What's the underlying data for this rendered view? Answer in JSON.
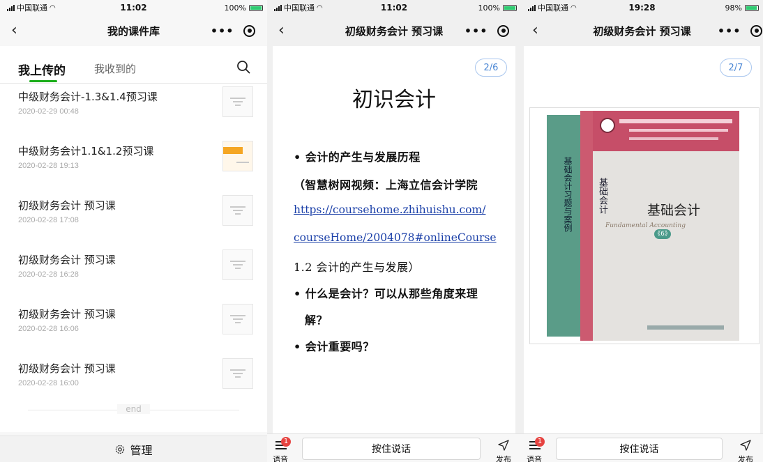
{
  "status_bars": [
    {
      "carrier": "中国联通",
      "time": "11:02",
      "battery": "100%"
    },
    {
      "carrier": "中国联通",
      "time": "11:02",
      "battery": "100%"
    },
    {
      "carrier": "中国联通",
      "time": "19:28",
      "battery": "98%"
    }
  ],
  "panel1": {
    "title": "我的课件库",
    "tabs": {
      "active": "我上传的",
      "inactive": "我收到的"
    },
    "items": [
      {
        "name": "中级财务会计-1.3&1.4预习课",
        "date": "2020-02-29 00:48"
      },
      {
        "name": "中级财务会计1.1&1.2预习课",
        "date": "2020-02-28 19:13"
      },
      {
        "name": "初级财务会计 预习课",
        "date": "2020-02-28 17:08"
      },
      {
        "name": "初级财务会计 预习课",
        "date": "2020-02-28 16:28"
      },
      {
        "name": "初级财务会计 预习课",
        "date": "2020-02-28 16:06"
      },
      {
        "name": "初级财务会计 预习课",
        "date": "2020-02-28 16:00"
      }
    ],
    "end_label": "end",
    "manage_label": "管理"
  },
  "panel2": {
    "title": "初级财务会计 预习课",
    "pager": "2/6",
    "slide_title": "初识会计",
    "lines": {
      "b1": "•  会计的产生与发展历程",
      "l2": "（智慧树网视频：上海立信会计学院",
      "l3": "https://coursehome.zhihuishu.com/",
      "l4": "courseHome/2004078#onlineCourse",
      "l5": "1.2 会计的产生与发展）",
      "b2": "•  什么是会计？可以从那些角度来理",
      "b2b": "解？",
      "b3": "•  会计重要吗？"
    }
  },
  "panel3": {
    "title": "初级财务会计 预习课",
    "pager": "2/7",
    "book": {
      "front_title": "基础会计",
      "front_vertical": "基础会计",
      "back_vertical": "基础会计习题与案例",
      "subtitle": "Fundamental Accounting",
      "edition": "《6》"
    }
  },
  "chat": {
    "voice_label": "语音",
    "voice_badge": "1",
    "push_to_talk": "按住说话",
    "send_label": "发布"
  }
}
